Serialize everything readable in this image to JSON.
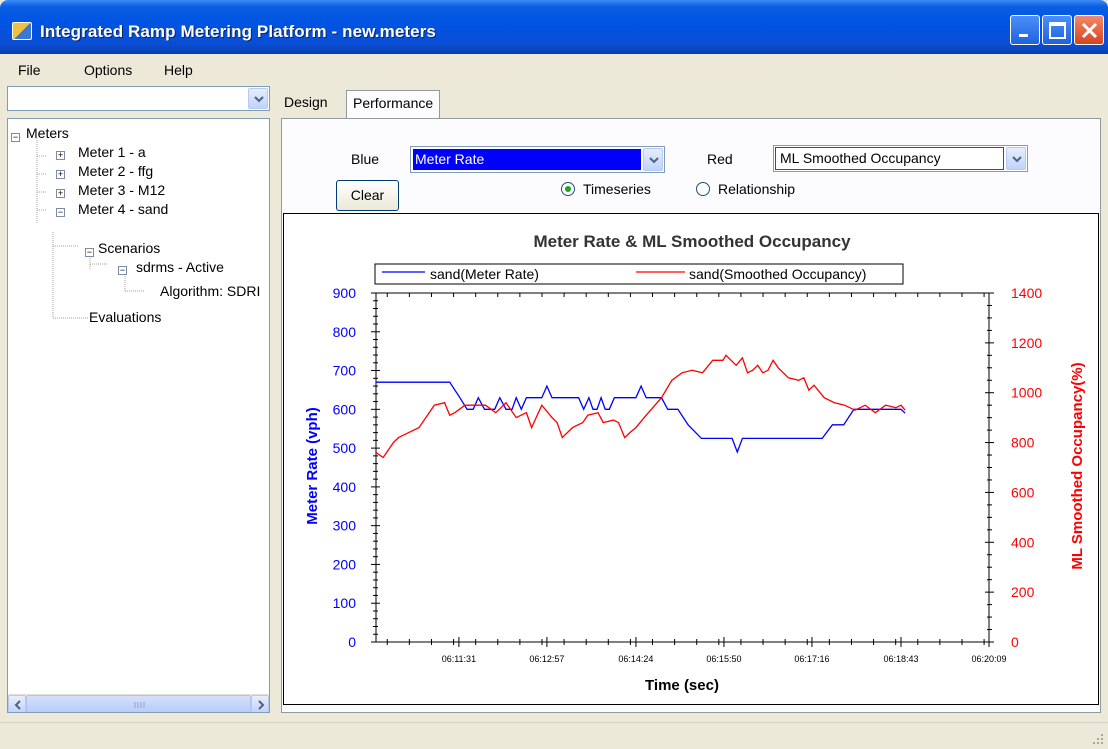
{
  "window": {
    "title": "Integrated Ramp Metering Platform - new.meters"
  },
  "menu": [
    "File",
    "Options",
    "Help"
  ],
  "sidebar": {
    "combo_value": "",
    "tree": [
      {
        "label": "Meters",
        "expander": "−"
      },
      {
        "label": "Meter 1 - a",
        "expander": "+"
      },
      {
        "label": "Meter 2 - ffg",
        "expander": "+"
      },
      {
        "label": "Meter 3 - M12",
        "expander": "+"
      },
      {
        "label": "Meter 4 - sand",
        "expander": "−"
      },
      {
        "label": "Scenarios",
        "expander": "−"
      },
      {
        "label": "sdrms - Active",
        "expander": "−"
      },
      {
        "label": "Algorithm: SDRI",
        "expander": ""
      },
      {
        "label": "Evaluations",
        "expander": ""
      }
    ]
  },
  "tabs": [
    "Design",
    "Performance"
  ],
  "controls": {
    "blue_label": "Blue",
    "blue_value": "Meter Rate",
    "red_label": "Red",
    "red_value": "ML Smoothed Occupancy",
    "clear_label": "Clear",
    "radio_timeseries": "Timeseries",
    "radio_relationship": "Relationship",
    "selected_mode": "Timeseries"
  },
  "colors": {
    "blue": "#0000ff",
    "red": "#ff0000"
  },
  "chart_data": {
    "type": "line",
    "title": "Meter Rate & ML Smoothed Occupancy",
    "xlabel": "Time (sec)",
    "ylabel": "Meter Rate (vph)",
    "y2label": "ML Smoothed Occupancy(%)",
    "ylim": [
      0,
      900
    ],
    "y2lim": [
      0,
      1400
    ],
    "yticks": [
      "0",
      "100",
      "200",
      "300",
      "400",
      "500",
      "600",
      "700",
      "800",
      "900"
    ],
    "y2ticks": [
      "0",
      "200",
      "400",
      "600",
      "800",
      "1000",
      "1200",
      "1400"
    ],
    "xticks": [
      "06:11:31",
      "06:12:57",
      "06:14:24",
      "06:15:50",
      "06:17:16",
      "06:18:43",
      "06:20:09"
    ],
    "xlim_seconds": [
      22210,
      22809
    ],
    "legend": [
      "sand(Meter Rate)",
      "sand(Smoothed Occupancy)"
    ],
    "series": [
      {
        "name": "sand(Meter Rate)",
        "axis": "left",
        "t": [
          "06:10:10",
          "06:11:22",
          "06:11:32",
          "06:11:39",
          "06:11:45",
          "06:11:50",
          "06:11:56",
          "06:12:06",
          "06:12:11",
          "06:12:17",
          "06:12:23",
          "06:12:27",
          "06:12:32",
          "06:12:37",
          "06:12:42",
          "06:12:49",
          "06:12:52",
          "06:12:57",
          "06:13:02",
          "06:13:08",
          "06:13:13",
          "06:13:18",
          "06:13:23",
          "06:13:28",
          "06:13:33",
          "06:13:38",
          "06:13:42",
          "06:13:46",
          "06:13:50",
          "06:13:54",
          "06:13:58",
          "06:14:03",
          "06:14:08",
          "06:14:13",
          "06:14:18",
          "06:14:24",
          "06:14:29",
          "06:14:34",
          "06:14:39",
          "06:14:44",
          "06:14:49",
          "06:14:55",
          "06:15:05",
          "06:15:15",
          "06:15:28",
          "06:15:38",
          "06:15:52",
          "06:15:58",
          "06:16:03",
          "06:16:08",
          "06:16:18",
          "06:16:34",
          "06:16:49",
          "06:17:05",
          "06:17:16",
          "06:17:26",
          "06:17:36",
          "06:17:47",
          "06:17:57",
          "06:18:07",
          "06:18:22",
          "06:18:38",
          "06:18:43",
          "06:18:47"
        ],
        "values": [
          670,
          670,
          630,
          600,
          600,
          630,
          600,
          600,
          630,
          600,
          600,
          630,
          600,
          630,
          630,
          630,
          630,
          660,
          630,
          630,
          630,
          630,
          630,
          630,
          600,
          630,
          600,
          600,
          630,
          600,
          600,
          630,
          630,
          630,
          630,
          630,
          660,
          630,
          630,
          630,
          630,
          600,
          600,
          560,
          525,
          525,
          525,
          525,
          490,
          525,
          525,
          525,
          525,
          525,
          525,
          525,
          560,
          560,
          600,
          600,
          600,
          600,
          600,
          590
        ]
      },
      {
        "name": "sand(Smoothed Occupancy)",
        "axis": "right",
        "t": [
          "06:10:10",
          "06:10:17",
          "06:10:22",
          "06:10:27",
          "06:10:32",
          "06:10:42",
          "06:10:52",
          "06:11:07",
          "06:11:17",
          "06:11:22",
          "06:11:27",
          "06:11:37",
          "06:11:47",
          "06:11:52",
          "06:11:57",
          "06:12:07",
          "06:12:17",
          "06:12:27",
          "06:12:37",
          "06:12:42",
          "06:12:52",
          "06:13:02",
          "06:13:07",
          "06:13:12",
          "06:13:22",
          "06:13:32",
          "06:13:37",
          "06:13:47",
          "06:13:52",
          "06:14:02",
          "06:14:07",
          "06:14:13",
          "06:14:18",
          "06:14:24",
          "06:14:34",
          "06:14:49",
          "06:14:59",
          "06:15:09",
          "06:15:19",
          "06:15:29",
          "06:15:39",
          "06:15:49",
          "06:15:52",
          "06:16:02",
          "06:16:08",
          "06:16:13",
          "06:16:18",
          "06:16:23",
          "06:16:28",
          "06:16:33",
          "06:16:38",
          "06:16:43",
          "06:16:48",
          "06:16:53",
          "06:17:03",
          "06:17:08",
          "06:17:13",
          "06:17:18",
          "06:17:28",
          "06:17:38",
          "06:17:48",
          "06:17:58",
          "06:18:08",
          "06:18:18",
          "06:18:28",
          "06:18:38",
          "06:18:43",
          "06:18:47"
        ],
        "values": [
          760,
          740,
          770,
          800,
          820,
          840,
          860,
          950,
          960,
          910,
          920,
          950,
          950,
          950,
          950,
          920,
          960,
          900,
          920,
          860,
          950,
          900,
          880,
          820,
          860,
          880,
          910,
          920,
          880,
          890,
          880,
          820,
          840,
          860,
          910,
          980,
          1050,
          1080,
          1090,
          1080,
          1130,
          1130,
          1150,
          1110,
          1140,
          1080,
          1090,
          1110,
          1080,
          1090,
          1130,
          1100,
          1080,
          1060,
          1050,
          1060,
          1010,
          1030,
          980,
          960,
          950,
          930,
          950,
          920,
          950,
          940,
          950,
          930
        ]
      }
    ]
  }
}
